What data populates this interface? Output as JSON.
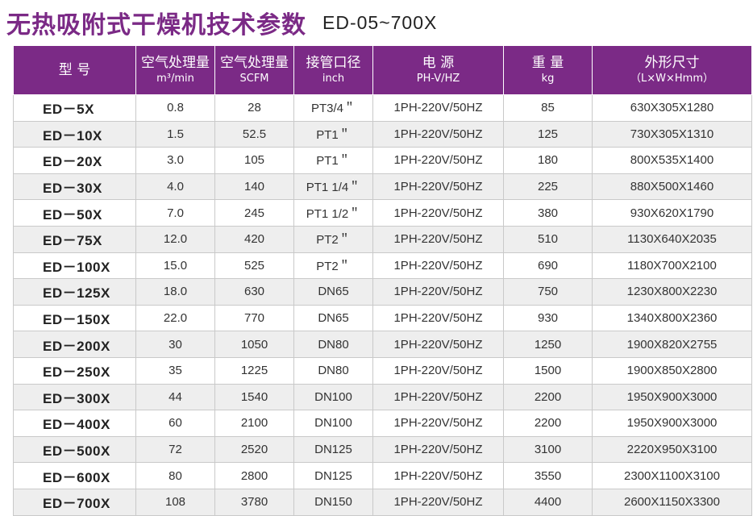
{
  "header": {
    "title_cn": "无热吸附式干燥机技术参数",
    "title_model": "ED-05~700X"
  },
  "table": {
    "columns": [
      {
        "main": "型  号",
        "sub": ""
      },
      {
        "main": "空气处理量",
        "sub": "m³/min"
      },
      {
        "main": "空气处理量",
        "sub": "SCFM"
      },
      {
        "main": "接管口径",
        "sub": "inch"
      },
      {
        "main": "电  源",
        "sub": "PH-V/HZ"
      },
      {
        "main": "重  量",
        "sub": "kg"
      },
      {
        "main": "外形尺寸",
        "sub": "（L×W×Hmm）"
      }
    ],
    "rows": [
      [
        "ED－5X",
        "0.8",
        "28",
        "PT3/4＂",
        "1PH-220V/50HZ",
        "85",
        "630X305X1280"
      ],
      [
        "ED－10X",
        "1.5",
        "52.5",
        "PT1＂",
        "1PH-220V/50HZ",
        "125",
        "730X305X1310"
      ],
      [
        "ED－20X",
        "3.0",
        "105",
        "PT1＂",
        "1PH-220V/50HZ",
        "180",
        "800X535X1400"
      ],
      [
        "ED－30X",
        "4.0",
        "140",
        "PT1 1/4＂",
        "1PH-220V/50HZ",
        "225",
        "880X500X1460"
      ],
      [
        "ED－50X",
        "7.0",
        "245",
        "PT1 1/2＂",
        "1PH-220V/50HZ",
        "380",
        "930X620X1790"
      ],
      [
        "ED－75X",
        "12.0",
        "420",
        "PT2＂",
        "1PH-220V/50HZ",
        "510",
        "1130X640X2035"
      ],
      [
        "ED－100X",
        "15.0",
        "525",
        "PT2＂",
        "1PH-220V/50HZ",
        "690",
        "1180X700X2100"
      ],
      [
        "ED－125X",
        "18.0",
        "630",
        "DN65",
        "1PH-220V/50HZ",
        "750",
        "1230X800X2230"
      ],
      [
        "ED－150X",
        "22.0",
        "770",
        "DN65",
        "1PH-220V/50HZ",
        "930",
        "1340X800X2360"
      ],
      [
        "ED－200X",
        "30",
        "1050",
        "DN80",
        "1PH-220V/50HZ",
        "1250",
        "1900X820X2755"
      ],
      [
        "ED－250X",
        "35",
        "1225",
        "DN80",
        "1PH-220V/50HZ",
        "1500",
        "1900X850X2800"
      ],
      [
        "ED－300X",
        "44",
        "1540",
        "DN100",
        "1PH-220V/50HZ",
        "2200",
        "1950X900X3000"
      ],
      [
        "ED－400X",
        "60",
        "2100",
        "DN100",
        "1PH-220V/50HZ",
        "2200",
        "1950X900X3000"
      ],
      [
        "ED－500X",
        "72",
        "2520",
        "DN125",
        "1PH-220V/50HZ",
        "3100",
        "2220X950X3100"
      ],
      [
        "ED－600X",
        "80",
        "2800",
        "DN125",
        "1PH-220V/50HZ",
        "3550",
        "2300X1100X3100"
      ],
      [
        "ED－700X",
        "108",
        "3780",
        "DN150",
        "1PH-220V/50HZ",
        "4400",
        "2600X1150X3300"
      ]
    ]
  },
  "colors": {
    "accent": "#7b2a86",
    "header_text": "#ffffff",
    "row_alt": "#eeeeee"
  }
}
